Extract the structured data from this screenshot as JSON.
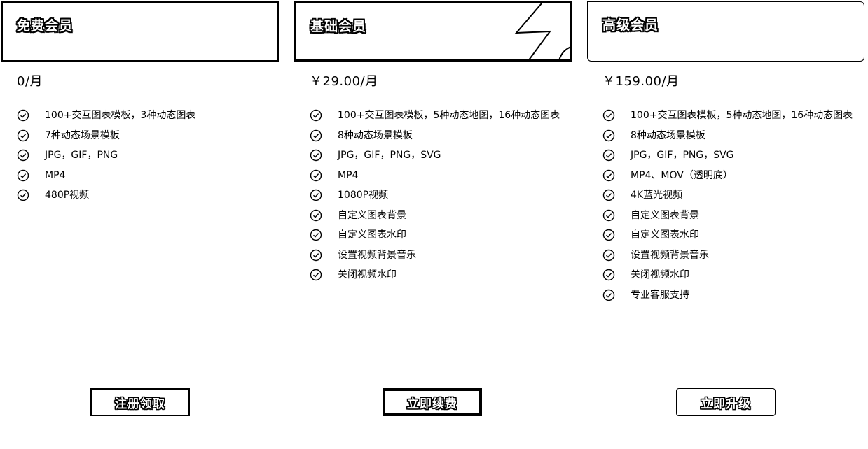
{
  "plans": [
    {
      "name": "免费会员",
      "price": "0/月",
      "features": [
        "100+交互图表模板，3种动态图表",
        "7种动态场景模板",
        "JPG，GIF，PNG",
        "MP4",
        "480P视频"
      ],
      "cta": "注册领取"
    },
    {
      "name": "基础会员",
      "price": "￥29.00/月",
      "features": [
        "100+交互图表模板，5种动态地图，16种动态图表",
        "8种动态场景模板",
        "JPG，GIF，PNG，SVG",
        "MP4",
        "1080P视频",
        "自定义图表背景",
        "自定义图表水印",
        "设置视频背景音乐",
        "关闭视频水印"
      ],
      "cta": "立即续费"
    },
    {
      "name": "高级会员",
      "price": "￥159.00/月",
      "features": [
        "100+交互图表模板，5种动态地图，16种动态图表",
        "8种动态场景模板",
        "JPG，GIF，PNG，SVG",
        "MP4、MOV（透明底）",
        "4K蓝光视频",
        "自定义图表背景",
        "自定义图表水印",
        "设置视频背景音乐",
        "关闭视频水印",
        "专业客服支持"
      ],
      "cta": "立即升级"
    }
  ],
  "icons": {
    "check": "check-circle-icon",
    "decoration": "lightning-decoration-icon"
  }
}
